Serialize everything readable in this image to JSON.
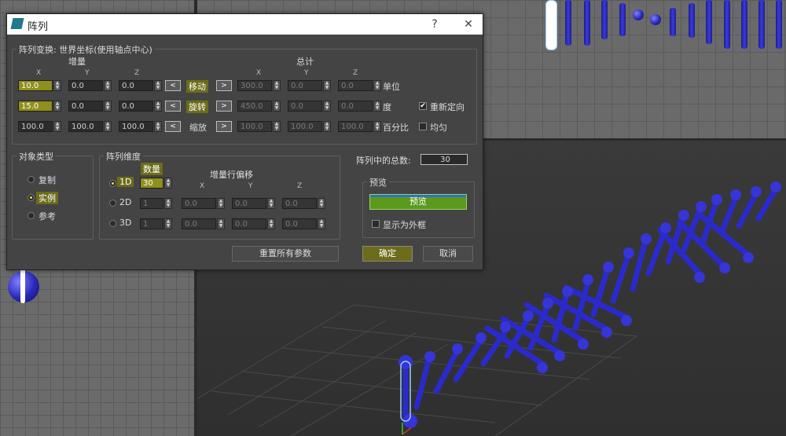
{
  "dialog": {
    "title": "阵列",
    "help_btn": "?",
    "close_btn": "✕",
    "array_transform": {
      "group_label": "阵列变换: 世界坐标(使用轴点中心)",
      "increment_label": "增量",
      "total_label": "总计",
      "axes": [
        "X",
        "Y",
        "Z"
      ],
      "move": {
        "label": "移动",
        "inc": [
          "10.0",
          "0.0",
          "0.0"
        ],
        "total": [
          "300.0",
          "0.0",
          "0.0"
        ],
        "unit": "单位"
      },
      "rotate": {
        "label": "旋转",
        "inc": [
          "15.0",
          "0.0",
          "0.0"
        ],
        "total": [
          "450.0",
          "0.0",
          "0.0"
        ],
        "unit": "度"
      },
      "scale": {
        "label": "缩放",
        "inc": [
          "100.0",
          "100.0",
          "100.0"
        ],
        "total": [
          "100.0",
          "100.0",
          "100.0"
        ],
        "unit": "百分比"
      },
      "left_arrow": "<",
      "right_arrow": ">",
      "reorient_label": "重新定向",
      "uniform_label": "均匀"
    },
    "object_type": {
      "group_label": "对象类型",
      "copy": "复制",
      "instance": "实例",
      "reference": "参考"
    },
    "dimensions": {
      "group_label": "阵列维度",
      "count_label": "数量",
      "offset_label": "增量行偏移",
      "axes": [
        "X",
        "Y",
        "Z"
      ],
      "rows": [
        {
          "label": "1D",
          "count": "30"
        },
        {
          "label": "2D",
          "count": "1",
          "offsets": [
            "0.0",
            "0.0",
            "0.0"
          ]
        },
        {
          "label": "3D",
          "count": "1",
          "offsets": [
            "0.0",
            "0.0",
            "0.0"
          ]
        }
      ]
    },
    "total_in_array_label": "阵列中的总数:",
    "total_in_array_value": "30",
    "preview": {
      "group_label": "预览",
      "button": "预览",
      "show_as_box": "显示为外框"
    },
    "reset_button": "重置所有参数",
    "ok_button": "确定",
    "cancel_button": "取消"
  },
  "colors": {
    "highlight": "#8f8f1c",
    "preview_green": "#5a9a1c",
    "object_blue": "#2828b8"
  }
}
